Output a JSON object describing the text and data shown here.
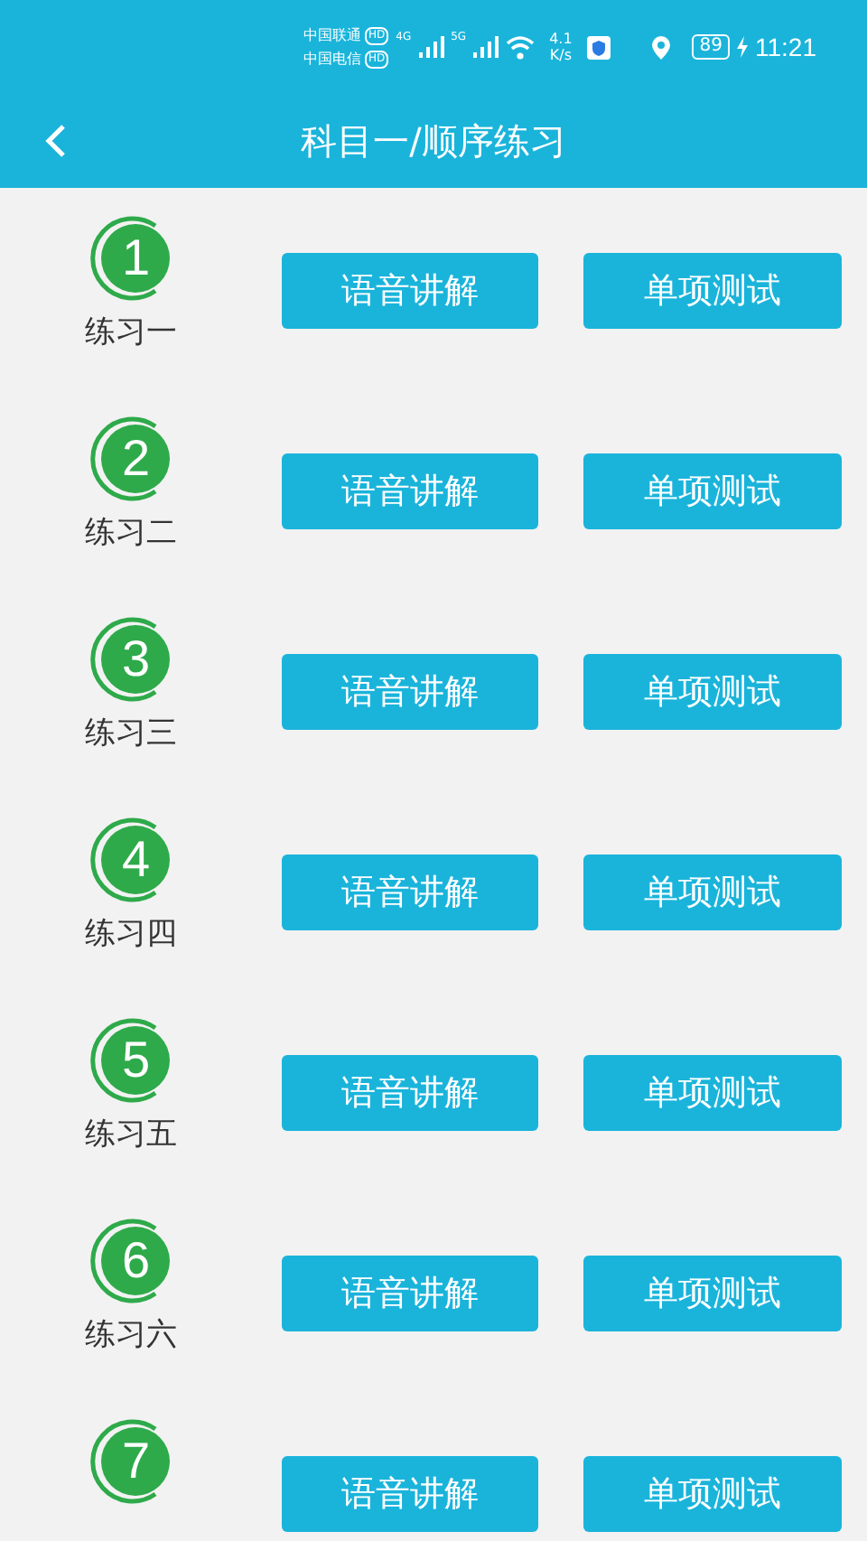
{
  "status_bar": {
    "carriers": [
      {
        "name": "中国联通",
        "badge": "HD"
      },
      {
        "name": "中国电信",
        "badge": "HD"
      }
    ],
    "signals": [
      "4G",
      "5G"
    ],
    "speed": [
      "4.1",
      "K/s"
    ],
    "battery": "89",
    "time": "11:21"
  },
  "header": {
    "title": "科目一/顺序练习"
  },
  "exercises": [
    {
      "number": "1",
      "label": "练习一",
      "buttons": [
        "语音讲解",
        "单项测试"
      ]
    },
    {
      "number": "2",
      "label": "练习二",
      "buttons": [
        "语音讲解",
        "单项测试"
      ]
    },
    {
      "number": "3",
      "label": "练习三",
      "buttons": [
        "语音讲解",
        "单项测试"
      ]
    },
    {
      "number": "4",
      "label": "练习四",
      "buttons": [
        "语音讲解",
        "单项测试"
      ]
    },
    {
      "number": "5",
      "label": "练习五",
      "buttons": [
        "语音讲解",
        "单项测试"
      ]
    },
    {
      "number": "6",
      "label": "练习六",
      "buttons": [
        "语音讲解",
        "单项测试"
      ]
    },
    {
      "number": "7",
      "buttons": [
        "语音讲解",
        "单项测试"
      ]
    }
  ]
}
